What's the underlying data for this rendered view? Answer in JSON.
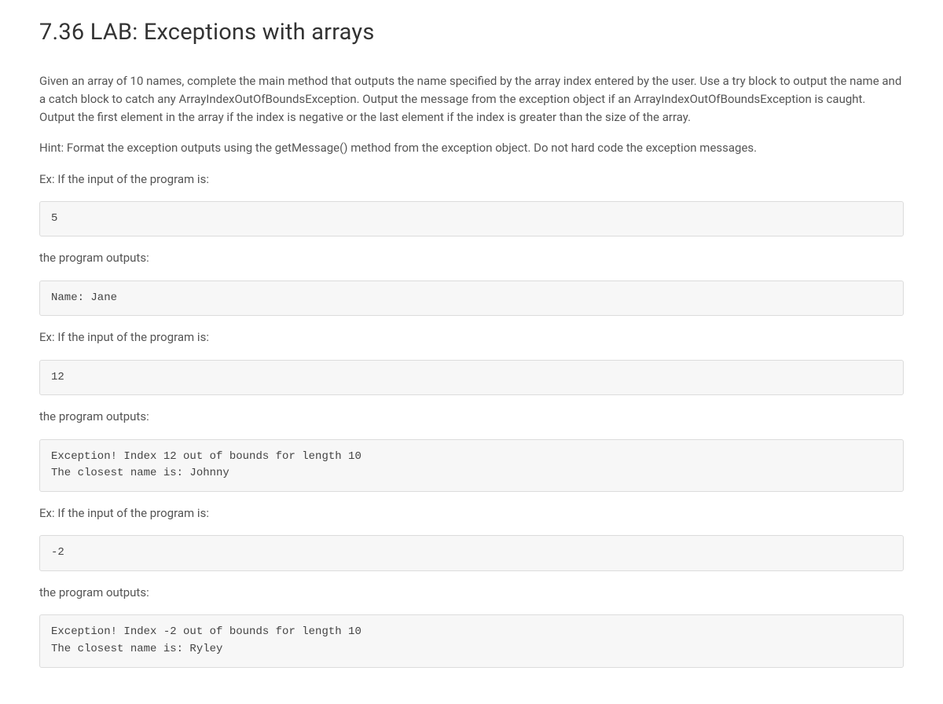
{
  "heading": "7.36 LAB: Exceptions with arrays",
  "paragraphs": {
    "intro": "Given an array of 10 names, complete the main method that outputs the name specified by the array index entered by the user. Use a try block to output the name and a catch block to catch any ArrayIndexOutOfBoundsException. Output the message from the exception object if an ArrayIndexOutOfBoundsException is caught. Output the first element in the array if the index is negative or the last element if the index is greater than the size of the array.",
    "hint": "Hint: Format the exception outputs using the getMessage() method from the exception object. Do not hard code the exception messages.",
    "ex1_prompt": "Ex: If the input of the program is:",
    "out_label1": "the program outputs:",
    "ex2_prompt": "Ex: If the input of the program is:",
    "out_label2": "the program outputs:",
    "ex3_prompt": "Ex: If the input of the program is:",
    "out_label3": "the program outputs:"
  },
  "examples": {
    "input1": "5",
    "output1": "Name: Jane",
    "input2": "12",
    "output2": "Exception! Index 12 out of bounds for length 10\nThe closest name is: Johnny",
    "input3": "-2",
    "output3": "Exception! Index -2 out of bounds for length 10\nThe closest name is: Ryley"
  }
}
